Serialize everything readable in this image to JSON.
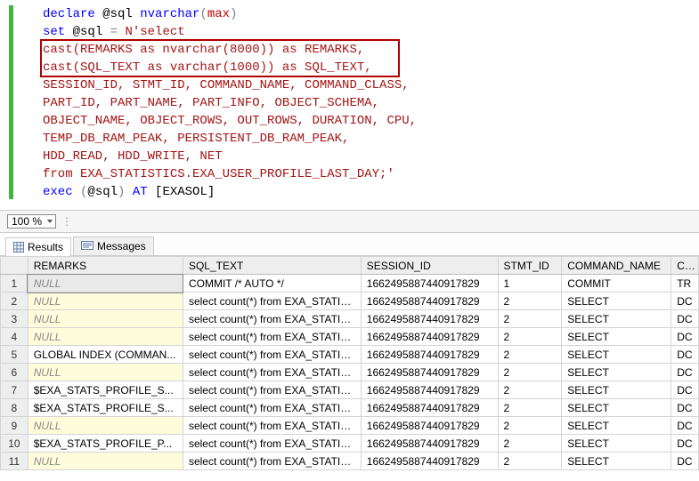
{
  "code": {
    "l1_declare": "declare",
    "l1_var": "@sql",
    "l1_type": "nvarchar",
    "l1_paren_open": "(",
    "l1_max": "max",
    "l1_paren_close": ")",
    "l2_set": "set",
    "l2_var": "@sql",
    "l2_eq": " = ",
    "l2_nquote": "N'select",
    "l3": "cast(REMARKS as nvarchar(8000)) as REMARKS,",
    "l4": "cast(SQL_TEXT as varchar(1000)) as SQL_TEXT,",
    "l5": "SESSION_ID, STMT_ID, COMMAND_NAME, COMMAND_CLASS,",
    "l6": "PART_ID, PART_NAME, PART_INFO, OBJECT_SCHEMA,",
    "l7": "OBJECT_NAME, OBJECT_ROWS, OUT_ROWS, DURATION, CPU,",
    "l8": "TEMP_DB_RAM_PEAK, PERSISTENT_DB_RAM_PEAK,",
    "l9": "HDD_READ, HDD_WRITE, NET",
    "l10": "from EXA_STATISTICS.EXA_USER_PROFILE_LAST_DAY;'",
    "l11_exec": "exec",
    "l11_paren_open": " (",
    "l11_var": "@sql",
    "l11_paren_close": ")",
    "l11_at": " AT ",
    "l11_link": "[EXASOL]"
  },
  "zoom": {
    "value": "100 %"
  },
  "tabs": {
    "results": "Results",
    "messages": "Messages"
  },
  "columns": {
    "rownum": "",
    "remarks": "REMARKS",
    "sql_text": "SQL_TEXT",
    "session_id": "SESSION_ID",
    "stmt_id": "STMT_ID",
    "command_name": "COMMAND_NAME",
    "co": "CO"
  },
  "rows": [
    {
      "n": "1",
      "remarks": "NULL",
      "remarks_null": true,
      "sql": "COMMIT /* AUTO */",
      "sess": "1662495887440917829",
      "stmt": "1",
      "cmd": "COMMIT",
      "co": "TR"
    },
    {
      "n": "2",
      "remarks": "NULL",
      "remarks_null": true,
      "sql": "select count(*) from EXA_STATIS...",
      "sess": "1662495887440917829",
      "stmt": "2",
      "cmd": "SELECT",
      "co": "DC"
    },
    {
      "n": "3",
      "remarks": "NULL",
      "remarks_null": true,
      "sql": "select count(*) from EXA_STATIS...",
      "sess": "1662495887440917829",
      "stmt": "2",
      "cmd": "SELECT",
      "co": "DC"
    },
    {
      "n": "4",
      "remarks": "NULL",
      "remarks_null": true,
      "sql": "select count(*) from EXA_STATIS...",
      "sess": "1662495887440917829",
      "stmt": "2",
      "cmd": "SELECT",
      "co": "DC"
    },
    {
      "n": "5",
      "remarks": "GLOBAL INDEX (COMMAN...",
      "remarks_null": false,
      "sql": "select count(*) from EXA_STATIS...",
      "sess": "1662495887440917829",
      "stmt": "2",
      "cmd": "SELECT",
      "co": "DC"
    },
    {
      "n": "6",
      "remarks": "NULL",
      "remarks_null": true,
      "sql": "select count(*) from EXA_STATIS...",
      "sess": "1662495887440917829",
      "stmt": "2",
      "cmd": "SELECT",
      "co": "DC"
    },
    {
      "n": "7",
      "remarks": "$EXA_STATS_PROFILE_S...",
      "remarks_null": false,
      "sql": "select count(*) from EXA_STATIS...",
      "sess": "1662495887440917829",
      "stmt": "2",
      "cmd": "SELECT",
      "co": "DC"
    },
    {
      "n": "8",
      "remarks": "$EXA_STATS_PROFILE_S...",
      "remarks_null": false,
      "sql": "select count(*) from EXA_STATIS...",
      "sess": "1662495887440917829",
      "stmt": "2",
      "cmd": "SELECT",
      "co": "DC"
    },
    {
      "n": "9",
      "remarks": "NULL",
      "remarks_null": true,
      "sql": "select count(*) from EXA_STATIS...",
      "sess": "1662495887440917829",
      "stmt": "2",
      "cmd": "SELECT",
      "co": "DC"
    },
    {
      "n": "10",
      "remarks": "$EXA_STATS_PROFILE_P...",
      "remarks_null": false,
      "sql": "select count(*) from EXA_STATIS...",
      "sess": "1662495887440917829",
      "stmt": "2",
      "cmd": "SELECT",
      "co": "DC"
    },
    {
      "n": "11",
      "remarks": "NULL",
      "remarks_null": true,
      "sql": "select count(*) from EXA_STATIS...",
      "sess": "1662495887440917829",
      "stmt": "2",
      "cmd": "SELECT",
      "co": "DC"
    }
  ]
}
